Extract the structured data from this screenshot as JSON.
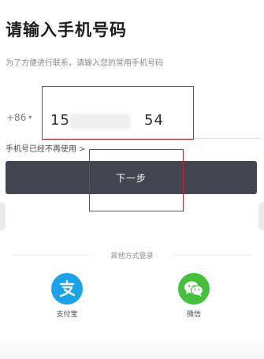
{
  "header": {
    "title": "请输入手机号码",
    "subtitle": "为了方便进行联系，请输入您的常用手机号码"
  },
  "phone": {
    "country_code": "+86",
    "value": "15              54"
  },
  "no_longer_link": "手机号已经不再使用 >",
  "next_button": "下一步",
  "other_login": {
    "label": "其他方式登录",
    "options": [
      {
        "label": "支付宝",
        "icon": "alipay-icon",
        "color": "#1aa3e8"
      },
      {
        "label": "微信",
        "icon": "wechat-icon",
        "color": "#44c03a"
      }
    ]
  },
  "colors": {
    "button_bg": "#434551",
    "annotation": "#c0272d"
  }
}
